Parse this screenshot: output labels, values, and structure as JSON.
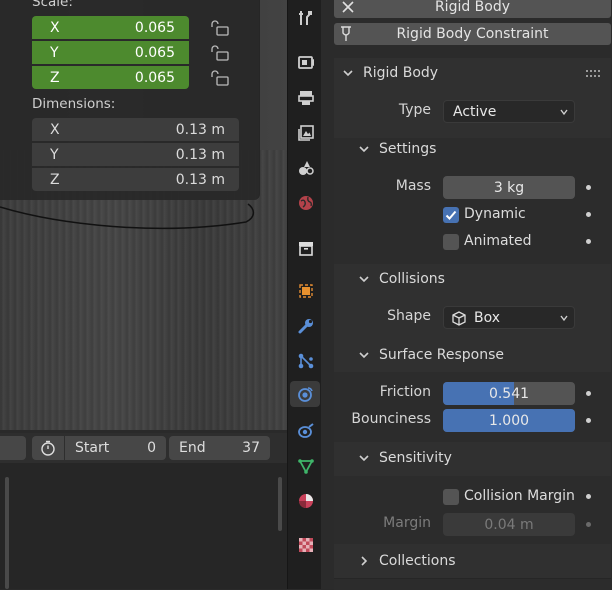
{
  "viewport": {
    "scale_label": "Scale:",
    "scale": [
      {
        "axis": "X",
        "value": "0.065"
      },
      {
        "axis": "Y",
        "value": "0.065"
      },
      {
        "axis": "Z",
        "value": "0.065"
      }
    ],
    "dimensions_label": "Dimensions:",
    "dimensions": [
      {
        "axis": "X",
        "value": "0.13 m"
      },
      {
        "axis": "Y",
        "value": "0.13 m"
      },
      {
        "axis": "Z",
        "value": "0.13 m"
      }
    ]
  },
  "timeline": {
    "start_label": "Start",
    "start_value": "0",
    "end_label": "End",
    "end_value": "37"
  },
  "tabs": [
    "tool-icon",
    "render-icon",
    "output-icon",
    "view-layer-icon",
    "scene-icon",
    "world-icon",
    "collection-icon",
    "object-icon",
    "modifier-icon",
    "particles-icon",
    "physics-icon",
    "constraints-icon",
    "data-icon",
    "material-icon",
    "texture-icon"
  ],
  "properties": {
    "rigid_body_button": "Rigid Body",
    "rigid_body_constraint_button": "Rigid Body Constraint",
    "panel_title": "Rigid Body",
    "type_label": "Type",
    "type_value": "Active",
    "settings": {
      "title": "Settings",
      "mass_label": "Mass",
      "mass_value": "3 kg",
      "dynamic_label": "Dynamic",
      "dynamic_checked": true,
      "animated_label": "Animated",
      "animated_checked": false
    },
    "collisions": {
      "title": "Collisions",
      "shape_label": "Shape",
      "shape_value": "Box"
    },
    "surface_response": {
      "title": "Surface Response",
      "friction_label": "Friction",
      "friction_value": "0.541",
      "friction_fraction": 0.541,
      "bounciness_label": "Bounciness",
      "bounciness_value": "1.000",
      "bounciness_fraction": 1.0
    },
    "sensitivity": {
      "title": "Sensitivity",
      "collision_margin_label": "Collision Margin",
      "collision_margin_checked": false,
      "margin_label": "Margin",
      "margin_value": "0.04 m"
    },
    "collections_title": "Collections"
  },
  "colors": {
    "accent_blue": "#4772b3",
    "scale_green": "#4d8a2e",
    "physics_tab": "#5a8fd8"
  }
}
